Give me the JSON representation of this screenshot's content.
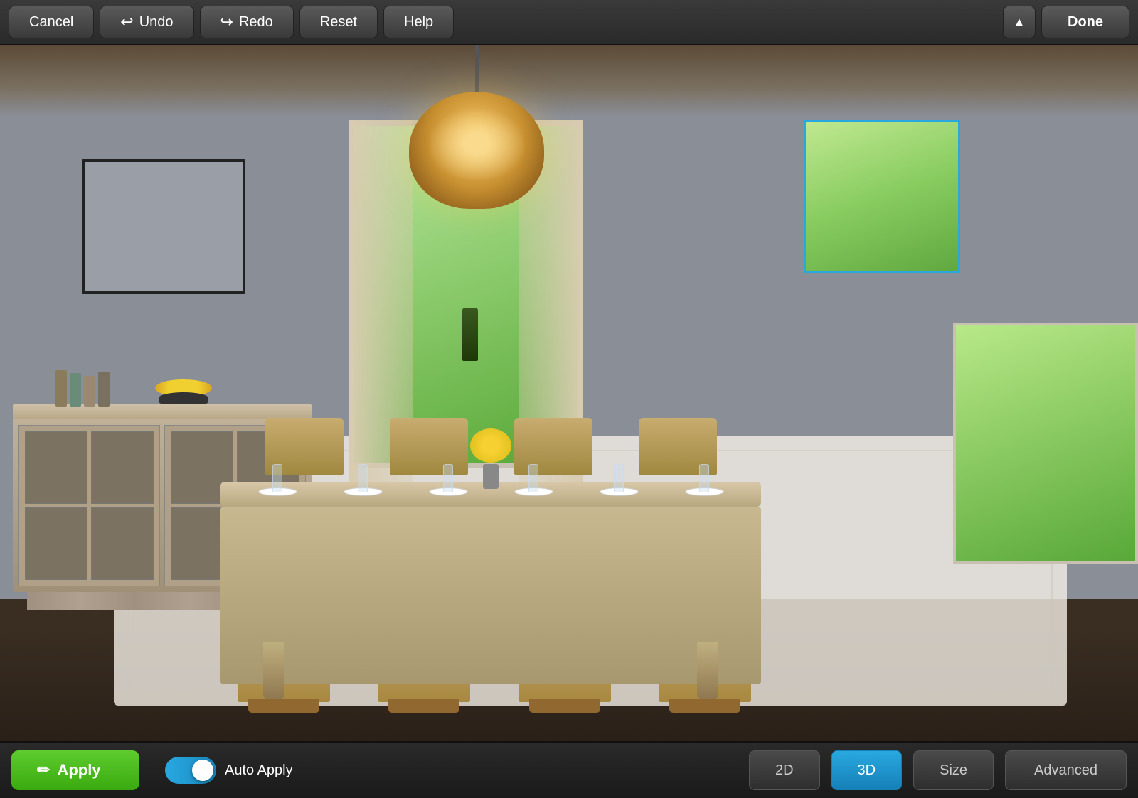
{
  "toolbar": {
    "cancel_label": "Cancel",
    "undo_label": "Undo",
    "redo_label": "Redo",
    "reset_label": "Reset",
    "help_label": "Help",
    "done_label": "Done",
    "collapse_icon": "▲"
  },
  "bottom_bar": {
    "apply_label": "Apply",
    "apply_icon": "✏",
    "auto_apply_label": "Auto Apply",
    "view_2d_label": "2D",
    "view_3d_label": "3D",
    "size_label": "Size",
    "advanced_label": "Advanced",
    "active_view": "3D"
  },
  "scene": {
    "selection_active": true
  }
}
